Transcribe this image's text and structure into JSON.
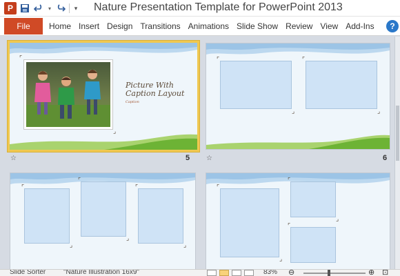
{
  "app": {
    "title": "Nature Presentation Template for PowerPoint 2013",
    "logo_letter": "P"
  },
  "qat": {
    "save_icon": "save-icon",
    "undo_icon": "undo-icon",
    "redo_icon": "redo-icon",
    "customize_icon": "chevron-down-icon"
  },
  "ribbon": {
    "file_label": "File",
    "tabs": [
      "Home",
      "Insert",
      "Design",
      "Transitions",
      "Animations",
      "Slide Show",
      "Review",
      "View",
      "Add-Ins"
    ],
    "help_label": "?"
  },
  "slides": [
    {
      "number": "5",
      "caption_title_1": "Picture With",
      "caption_title_2": "Caption Layout",
      "caption_sub": "Caption",
      "selected": true
    },
    {
      "number": "6"
    },
    {
      "number": ""
    },
    {
      "number": ""
    }
  ],
  "status": {
    "view_label": "Slide Sorter",
    "theme_label": "\"Nature Illustration 16x9\"",
    "zoom": "83%"
  },
  "colors": {
    "file_tab": "#d04a26",
    "selected_border": "#f0c850",
    "placeholder": "#cfe3f6",
    "hill_green": "#7cbb3c"
  }
}
